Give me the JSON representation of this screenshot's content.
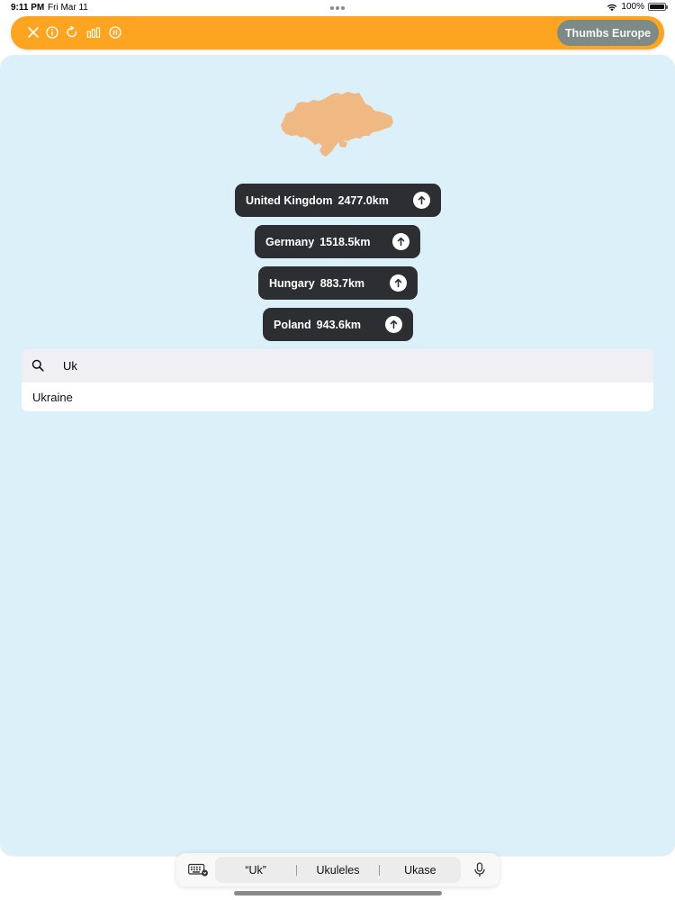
{
  "status_bar": {
    "time": "9:11 PM",
    "date": "Fri Mar 11",
    "battery": "100%"
  },
  "toolbar": {
    "icons": [
      "close-icon",
      "info-icon",
      "restart-icon",
      "stats-icon",
      "pause-icon"
    ],
    "mode_label": "Thumbs Europe",
    "accent_color": "#fda521",
    "mode_button_color": "#7e8a86"
  },
  "target_country": {
    "shape_icon": "country-silhouette-icon",
    "shape_color": "#f0b883"
  },
  "guesses": [
    {
      "country": "United Kingdom",
      "distance": "2477.0km",
      "direction_icon": "arrow-up-icon"
    },
    {
      "country": "Germany",
      "distance": "1518.5km",
      "direction_icon": "arrow-up-icon"
    },
    {
      "country": "Hungary",
      "distance": "883.7km",
      "direction_icon": "arrow-up-icon"
    },
    {
      "country": "Poland",
      "distance": "943.6km",
      "direction_icon": "arrow-up-icon"
    }
  ],
  "search": {
    "value": "Uk",
    "suggestions": [
      "Ukraine"
    ]
  },
  "keyboard_bar": {
    "suggestions": [
      "“Uk”",
      "Ukuleles",
      "Ukase"
    ]
  },
  "colors": {
    "panel_background": "#dcf0fa",
    "pill_background": "#2d2e31"
  }
}
